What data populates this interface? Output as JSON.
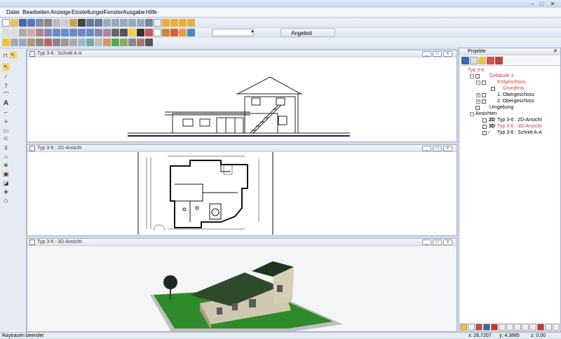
{
  "menu": [
    "Datei",
    "Bearbeiten",
    "Anzeige",
    "Einstellungen",
    "Fenster",
    "Ausgabe",
    "Hilfe"
  ],
  "toolbar": {
    "offer_label": "Angebot anfordern",
    "combo_value": ""
  },
  "windows": [
    {
      "title": "Typ 3-6 : Schnitt A-A"
    },
    {
      "title": "Typ 3-6 : 2D-Ansicht"
    },
    {
      "title": "Typ 3-6 : 3D-Ansicht"
    }
  ],
  "projects": {
    "title": "Projekte",
    "tree": {
      "root": "Typ 3-6",
      "building": "Gebäude 1",
      "ground_floor": "Erdgeschoss",
      "floor_plan": "Grundriss",
      "upper1": "1. Obergeschoss",
      "upper2": "2. Obergeschoss",
      "surroundings": "Umgebung",
      "views": "Ansichten",
      "view_2d": "Typ 3-6 : 2D-Ansicht",
      "view_3d": "Typ 3-6 : 3D-Ansicht",
      "view_section": "Typ 3-6 : Schnitt A-A",
      "tag_2d": "2D",
      "tag_3d": "3D"
    }
  },
  "status": {
    "message": "Raytracen beendet",
    "x": "x: 26,7207",
    "y": "y: 4,3885",
    "z": "z: 0,00"
  },
  "colors": {
    "accent_red": "#d04040",
    "roof": "#2f4a2b",
    "grass": "#2f8a2a"
  }
}
